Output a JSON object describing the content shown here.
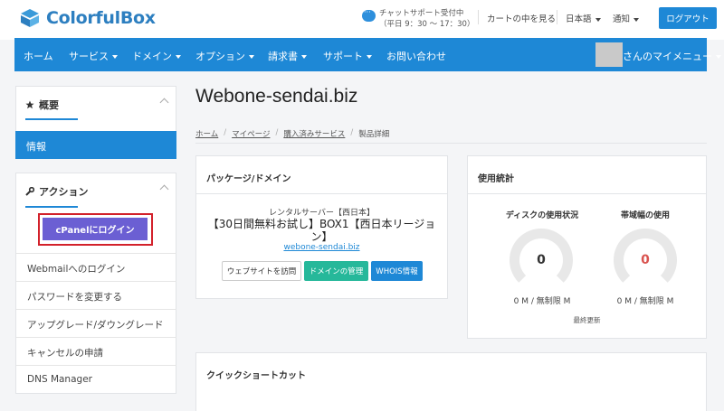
{
  "header": {
    "logo_text": "ColorfulBox",
    "support_line1": "チャットサポート受付中",
    "support_line2": "（平日 9：30 ～ 17：30）",
    "cart_label": "カートの中を見る",
    "language_label": "日本語",
    "notifications_label": "通知",
    "logout_label": "ログアウト"
  },
  "nav": {
    "items": [
      "ホーム",
      "サービス",
      "ドメイン",
      "オプション",
      "請求書",
      "サポート",
      "お問い合わせ"
    ],
    "my_menu_label": "さんのマイメニュー"
  },
  "sidebar": {
    "overview_title": "概要",
    "info_label": "情報",
    "actions_title": "アクション",
    "cpanel_label": "cPanelにログイン",
    "actions": [
      "Webmailへのログイン",
      "パスワードを変更する",
      "アップグレード/ダウングレード",
      "キャンセルの申請",
      "DNS Manager"
    ]
  },
  "main": {
    "title": "Webone-sendai.biz",
    "breadcrumb": [
      "ホーム",
      "マイページ",
      "購入済みサービス",
      "製品詳細"
    ],
    "package": {
      "title": "パッケージ/ドメイン",
      "server_type": "レンタルサーバー【西日本】",
      "plan_line1": "【30日間無料お試し】BOX1【西日本リージョ",
      "plan_line2": "ン】",
      "domain": "webone-sendai.biz",
      "visit_label": "ウェブサイトを訪問",
      "domain_mgmt_label": "ドメインの管理",
      "whois_label": "WHOIS情報"
    },
    "stats": {
      "title": "使用統計",
      "disk_label": "ディスクの使用状況",
      "disk_value": "0",
      "disk_usage": "0 M / 無制限 M",
      "bandwidth_label": "帯域幅の使用",
      "bandwidth_value": "0",
      "bandwidth_usage": "0 M / 無制限 M",
      "last_updated": "最終更新"
    },
    "shortcuts_title": "クイックショートカット"
  },
  "colors": {
    "primary": "#1e88d6",
    "cpanel": "#6b5fd3",
    "teal": "#26b89a",
    "highlight": "#d3212b",
    "bandwidth_value": "#d9534f"
  }
}
